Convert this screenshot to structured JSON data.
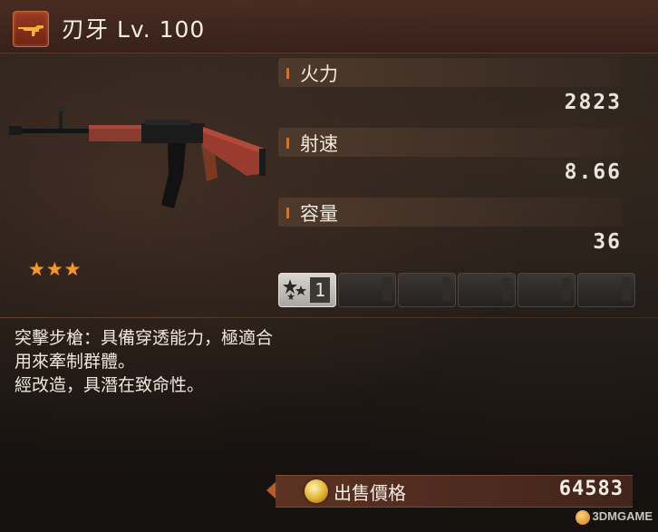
{
  "weapon": {
    "title": "刃牙 Lv. 100",
    "badge_icon": "rifle-icon",
    "stars": "★★★",
    "star_count": 3
  },
  "stats": [
    {
      "label": "火力",
      "value": "2823"
    },
    {
      "label": "射速",
      "value": "8.66"
    },
    {
      "label": "容量",
      "value": "36"
    }
  ],
  "mod_slots": {
    "active_count": "1",
    "total": 6,
    "active_icon": "stars-mod-icon"
  },
  "description": {
    "lines": [
      "突擊步槍：具備穿透能力，極適合",
      "用來牽制群體。",
      "經改造，具潛在致命性。"
    ]
  },
  "sell": {
    "label": "出售價格",
    "value": "64583",
    "icon": "gold-coin-icon"
  },
  "watermark": {
    "text": "3DMGAME"
  },
  "colors": {
    "accent": "#d2702e",
    "star": "#f3992d",
    "header_bg": "#4b2d23"
  }
}
